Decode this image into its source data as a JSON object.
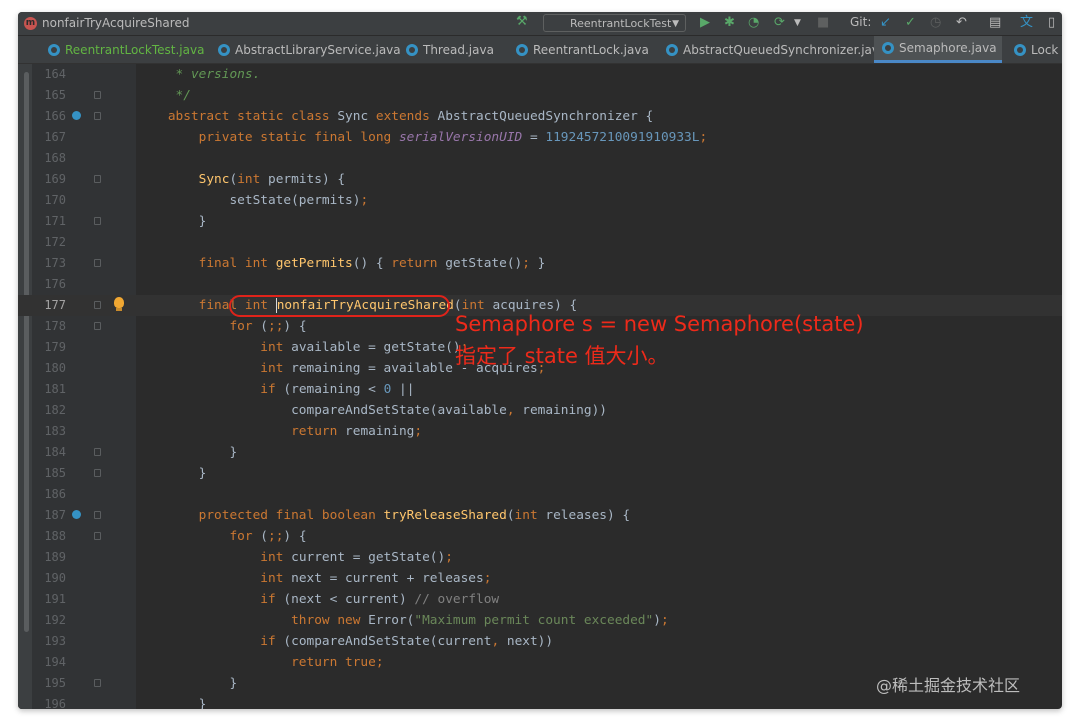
{
  "title_bar": {
    "method_badge": "m",
    "method_name": "nonfairTryAcquireShared",
    "run_config": "ReentrantLockTest",
    "git_label": "Git:",
    "icons": [
      "hammer-icon",
      "run-icon",
      "debug-icon",
      "coverage-icon",
      "profile-icon",
      "stop-icon",
      "git-update-icon",
      "git-commit-icon",
      "history-icon",
      "rollback-icon",
      "project-structure-icon",
      "translate-icon"
    ]
  },
  "tabs": [
    {
      "label": "ReentrantLockTest.java",
      "green": true
    },
    {
      "label": "AbstractLibraryService.java"
    },
    {
      "label": "Thread.java"
    },
    {
      "label": "ReentrantLock.java"
    },
    {
      "label": "AbstractQueuedSynchronizer.java"
    },
    {
      "label": "Semaphore.java",
      "active": true
    },
    {
      "label": "Lock"
    }
  ],
  "lines": [
    {
      "n": "164",
      "code": "     * versions."
    },
    {
      "n": "165",
      "code": "     */"
    },
    {
      "n": "166",
      "code": "    abstract static class Sync extends AbstractQueuedSynchronizer {"
    },
    {
      "n": "167",
      "code": "        private static final long serialVersionUID = 1192457210091910933L;"
    },
    {
      "n": "168",
      "code": ""
    },
    {
      "n": "169",
      "code": "        Sync(int permits) {"
    },
    {
      "n": "170",
      "code": "            setState(permits);"
    },
    {
      "n": "171",
      "code": "        }"
    },
    {
      "n": "172",
      "code": ""
    },
    {
      "n": "173",
      "code": "        final int getPermits() { return getState(); }"
    },
    {
      "n": "176",
      "code": ""
    },
    {
      "n": "177",
      "code": "        final int nonfairTryAcquireShared(int acquires) {"
    },
    {
      "n": "178",
      "code": "            for (;;) {"
    },
    {
      "n": "179",
      "code": "                int available = getState();"
    },
    {
      "n": "180",
      "code": "                int remaining = available - acquires;"
    },
    {
      "n": "181",
      "code": "                if (remaining < 0 ||"
    },
    {
      "n": "182",
      "code": "                    compareAndSetState(available, remaining))"
    },
    {
      "n": "183",
      "code": "                    return remaining;"
    },
    {
      "n": "184",
      "code": "            }"
    },
    {
      "n": "185",
      "code": "        }"
    },
    {
      "n": "186",
      "code": ""
    },
    {
      "n": "187",
      "code": "        protected final boolean tryReleaseShared(int releases) {"
    },
    {
      "n": "188",
      "code": "            for (;;) {"
    },
    {
      "n": "189",
      "code": "                int current = getState();"
    },
    {
      "n": "190",
      "code": "                int next = current + releases;"
    },
    {
      "n": "191",
      "code": "                if (next < current) // overflow"
    },
    {
      "n": "192",
      "code": "                    throw new Error(\"Maximum permit count exceeded\");"
    },
    {
      "n": "193",
      "code": "                if (compareAndSetState(current, next))"
    },
    {
      "n": "194",
      "code": "                    return true;"
    },
    {
      "n": "195",
      "code": "            }"
    },
    {
      "n": "196",
      "code": "        }"
    }
  ],
  "annotation": {
    "line1": "Semaphore s = new Semaphore(state)",
    "line2": "指定了 state 值大小。"
  },
  "watermark": "@稀土掘金技术社区",
  "colors": {
    "annotation": "#ee2a1a",
    "background": "#2b2b2b",
    "accent": "#4a88c7"
  }
}
